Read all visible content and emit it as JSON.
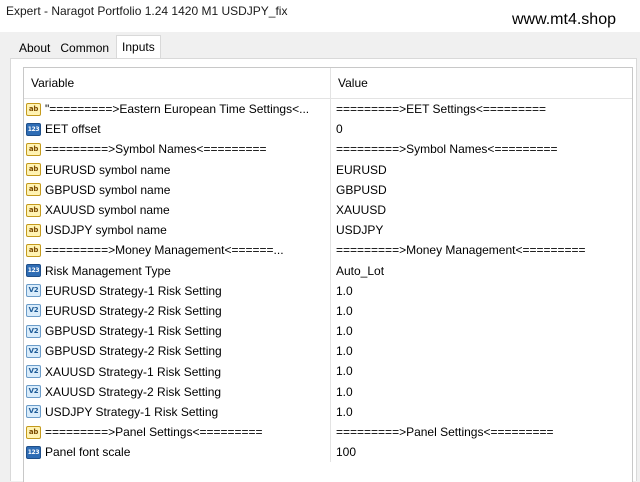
{
  "window": {
    "title": "Expert - Naragot Portfolio 1.24 1420 M1 USDJPY_fix",
    "watermark": "www.mt4.shop"
  },
  "tabs": [
    {
      "label": "About"
    },
    {
      "label": "Common"
    },
    {
      "label": "Inputs",
      "active": true
    }
  ],
  "table": {
    "headers": {
      "variable": "Variable",
      "value": "Value"
    },
    "rows": [
      {
        "icon": "ab-string-icon",
        "variable": "\"=========>Eastern European Time Settings<...",
        "value": "=========>EET Settings<========="
      },
      {
        "icon": "123-integer-icon",
        "variable": "EET offset",
        "value": "0"
      },
      {
        "icon": "ab-string-icon",
        "variable": "=========>Symbol Names<=========",
        "value": "=========>Symbol Names<========="
      },
      {
        "icon": "ab-string-icon",
        "variable": "EURUSD symbol name",
        "value": "EURUSD"
      },
      {
        "icon": "ab-string-icon",
        "variable": "GBPUSD symbol name",
        "value": "GBPUSD"
      },
      {
        "icon": "ab-string-icon",
        "variable": "XAUUSD symbol name",
        "value": "XAUUSD"
      },
      {
        "icon": "ab-string-icon",
        "variable": "USDJPY symbol name",
        "value": "USDJPY"
      },
      {
        "icon": "ab-string-icon",
        "variable": "=========>Money Management<======...",
        "value": "=========>Money Management<========="
      },
      {
        "icon": "123-integer-icon",
        "variable": "Risk Management Type",
        "value": "Auto_Lot"
      },
      {
        "icon": "v2-double-icon",
        "variable": "EURUSD Strategy-1 Risk Setting",
        "value": "1.0"
      },
      {
        "icon": "v2-double-icon",
        "variable": "EURUSD Strategy-2 Risk Setting",
        "value": "1.0"
      },
      {
        "icon": "v2-double-icon",
        "variable": "GBPUSD Strategy-1 Risk Setting",
        "value": "1.0"
      },
      {
        "icon": "v2-double-icon",
        "variable": "GBPUSD Strategy-2 Risk Setting",
        "value": "1.0"
      },
      {
        "icon": "v2-double-icon",
        "variable": "XAUUSD Strategy-1 Risk Setting",
        "value": "1.0"
      },
      {
        "icon": "v2-double-icon",
        "variable": "XAUUSD Strategy-2 Risk Setting",
        "value": "1.0"
      },
      {
        "icon": "v2-double-icon",
        "variable": "USDJPY Strategy-1 Risk Setting",
        "value": "1.0"
      },
      {
        "icon": "ab-string-icon",
        "variable": "=========>Panel Settings<=========",
        "value": "=========>Panel Settings<========="
      },
      {
        "icon": "123-integer-icon",
        "variable": "Panel font scale",
        "value": "100"
      }
    ]
  },
  "icon_glyphs": {
    "ab-string-icon": "ab",
    "123-integer-icon": "123",
    "v2-double-icon": "V2"
  }
}
